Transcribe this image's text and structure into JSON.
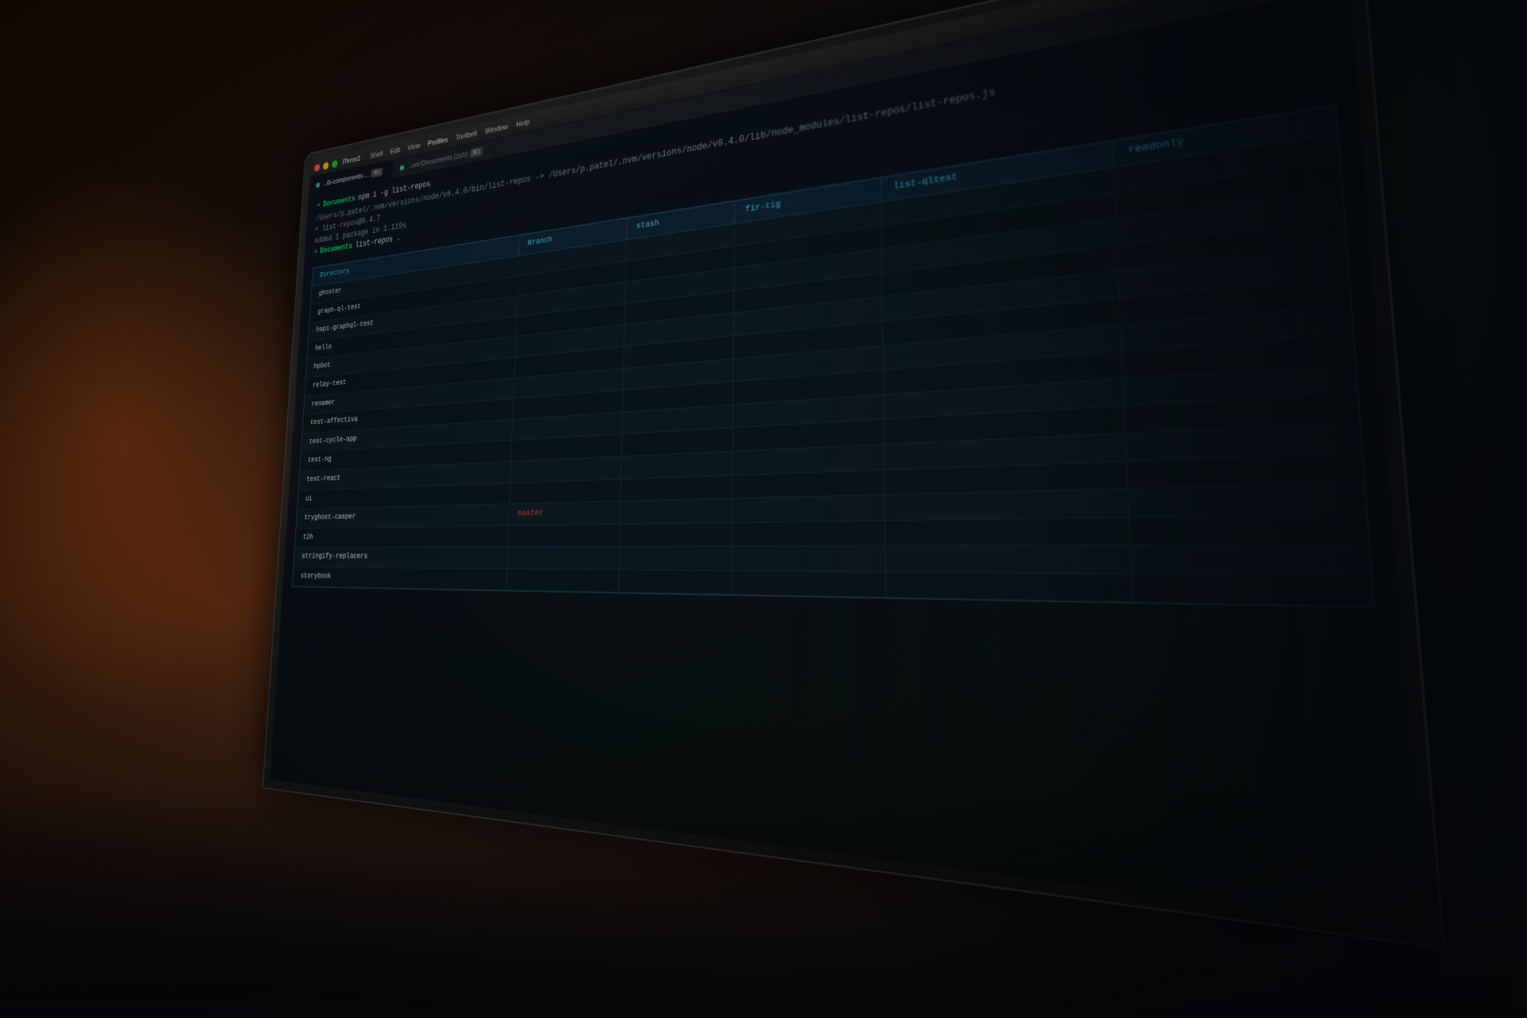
{
  "scene": {
    "background": "dark laptop with terminal"
  },
  "titlebar": {
    "app_name": "iTerm2",
    "menu_items": [
      "Shell",
      "Edit",
      "View",
      "Profiles",
      "Toolbelt",
      "Window",
      "Help"
    ]
  },
  "tabs": [
    {
      "label": "...ib-components-...",
      "badge": "⌘1",
      "active": true
    },
    {
      "label": "...ver/Documents (zsh)",
      "badge": "⌘2",
      "active": false
    }
  ],
  "terminal": {
    "commands": [
      {
        "prompt_dir": "Documents",
        "command": "npm i -g list-repos"
      }
    ],
    "output_lines": [
      "/Users/p.patel/.nvm/versions/node/v8.4.0/bin/list-repos -> /Users/p.patel/.nvm/versions/node/v8.4.0/lib/node_modules/list-repos/list-repos.js",
      "+ list-repos@0.4.7",
      "added 1 package in 1.119s"
    ],
    "second_command": {
      "prompt_dir": "Documents",
      "command": "list-repos ."
    }
  },
  "table": {
    "headers": [
      "Directory",
      "Branch",
      "stash",
      "fir-tig",
      "list-qltest",
      "readonly"
    ],
    "rows": [
      {
        "directory": "ghoster",
        "branch": "",
        "stash": "",
        "firtig": "",
        "listql": "",
        "readonly": ""
      },
      {
        "directory": "graph-ql-test",
        "branch": "",
        "stash": "",
        "firtig": "",
        "listql": "",
        "readonly": ""
      },
      {
        "directory": "hapi-graphql-test",
        "branch": "",
        "stash": "",
        "firtig": "",
        "listql": "",
        "readonly": ""
      },
      {
        "directory": "hello",
        "branch": "",
        "stash": "",
        "firtig": "",
        "listql": "",
        "readonly": ""
      },
      {
        "directory": "hpbot",
        "branch": "",
        "stash": "",
        "firtig": "",
        "listql": "",
        "readonly": ""
      },
      {
        "directory": "relay-test",
        "branch": "",
        "stash": "",
        "firtig": "",
        "listql": "",
        "readonly": ""
      },
      {
        "directory": "renamer",
        "branch": "",
        "stash": "",
        "firtig": "",
        "listql": "",
        "readonly": ""
      },
      {
        "directory": "test-affectiva",
        "branch": "",
        "stash": "",
        "firtig": "",
        "listql": "",
        "readonly": ""
      },
      {
        "directory": "test-cycle-app",
        "branch": "",
        "stash": "",
        "firtig": "",
        "listql": "",
        "readonly": ""
      },
      {
        "directory": "test-ng",
        "branch": "",
        "stash": "",
        "firtig": "",
        "listql": "",
        "readonly": ""
      },
      {
        "directory": "test-react",
        "branch": "",
        "stash": "",
        "firtig": "",
        "listql": "",
        "readonly": ""
      },
      {
        "directory": "ui",
        "branch": "",
        "stash": "",
        "firtig": "",
        "listql": "",
        "readonly": ""
      },
      {
        "directory": "tryghost-casper",
        "branch": "master",
        "stash": "",
        "firtig": "",
        "listql": "",
        "readonly": ""
      },
      {
        "directory": "t2h",
        "branch": "",
        "stash": "",
        "firtig": "",
        "listql": "",
        "readonly": ""
      },
      {
        "directory": "stringify-replacers",
        "branch": "",
        "stash": "",
        "firtig": "",
        "listql": "",
        "readonly": ""
      },
      {
        "directory": "storybook",
        "branch": "",
        "stash": "",
        "firtig": "",
        "listql": "",
        "readonly": ""
      }
    ]
  }
}
